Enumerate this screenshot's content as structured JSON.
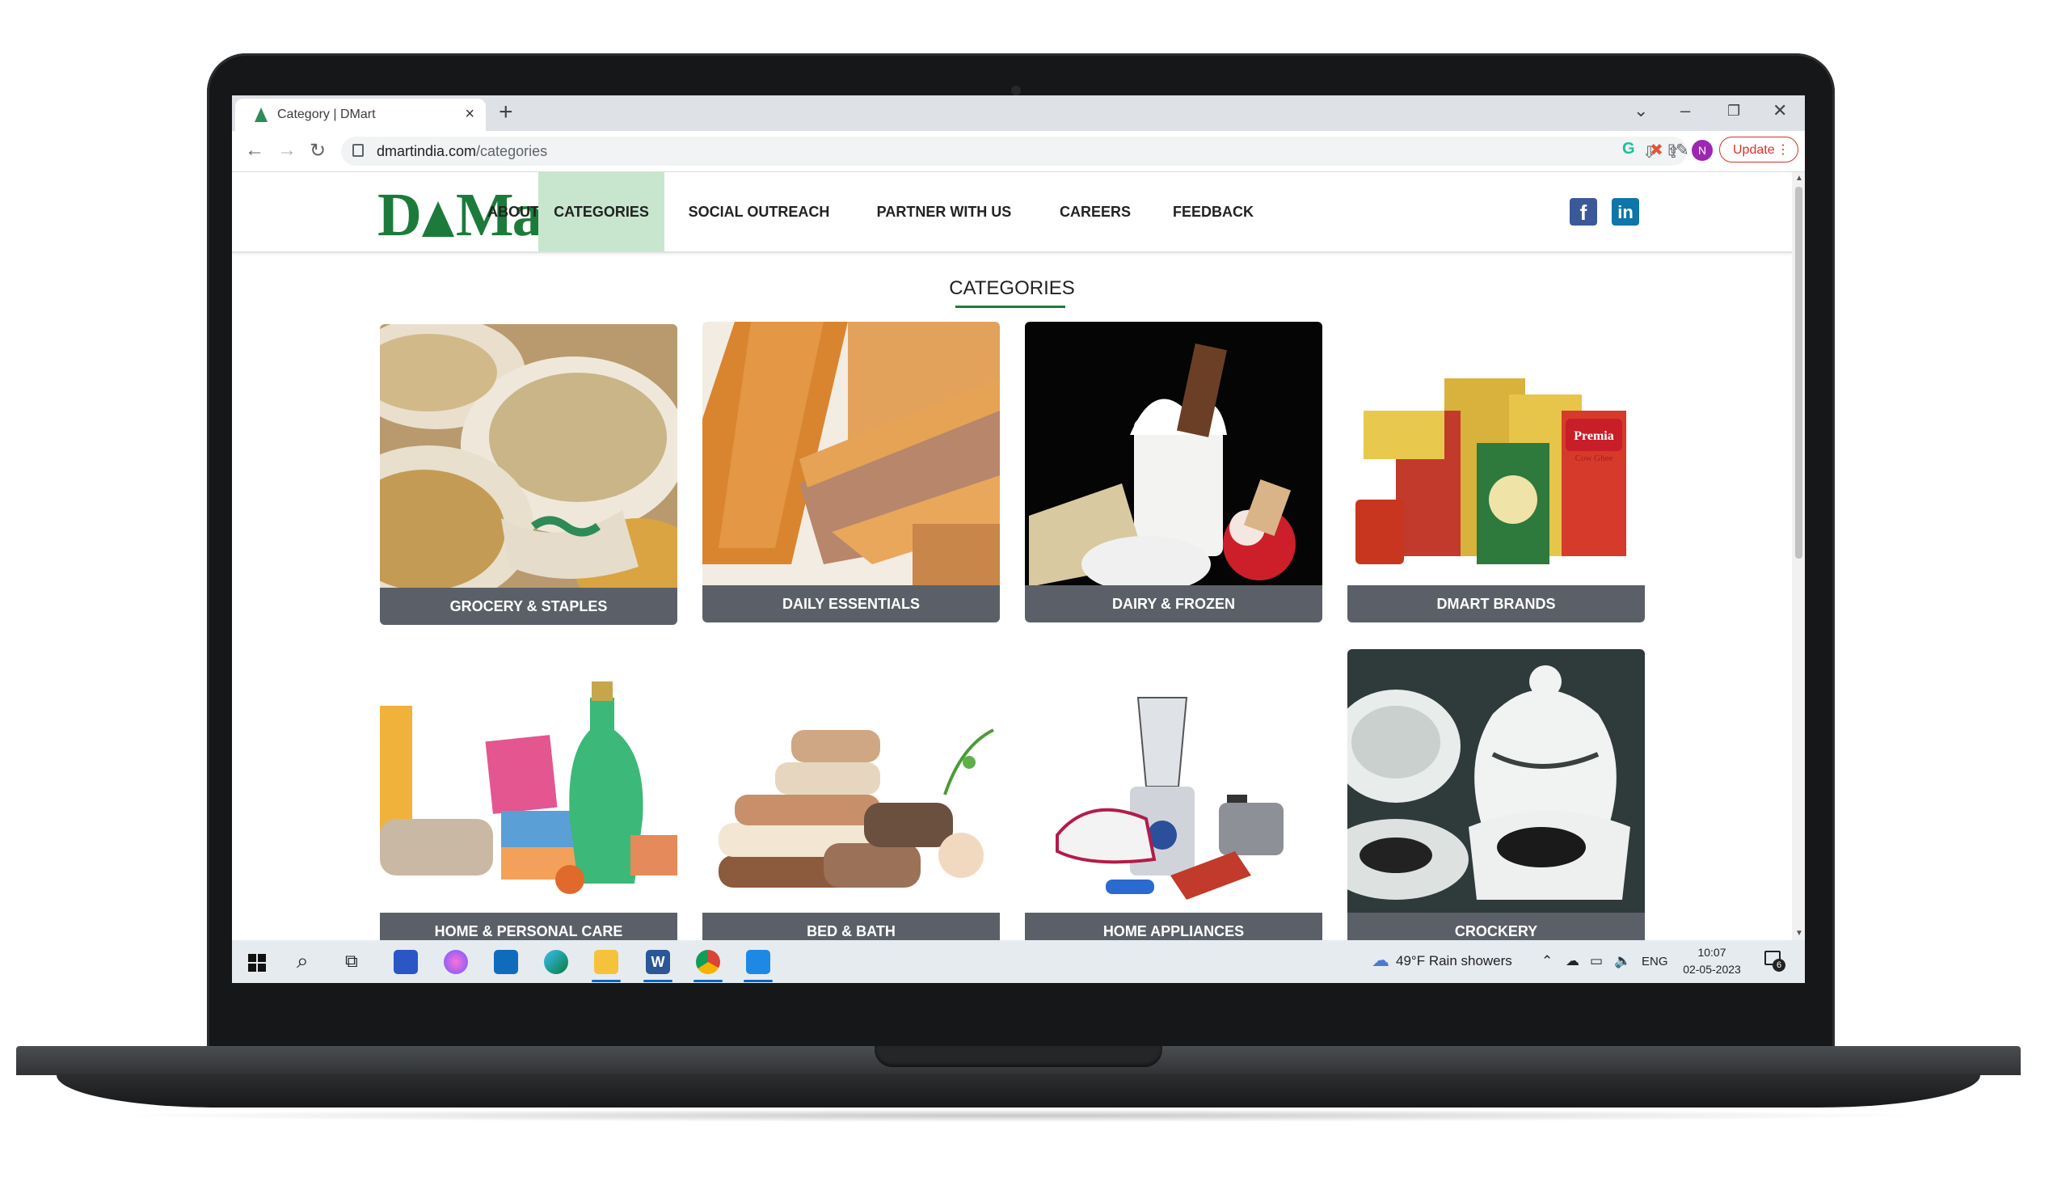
{
  "browser": {
    "tab_title": "Category | DMart",
    "new_tab": "+",
    "close_tab": "×",
    "url_host": "dmartindia.com",
    "url_path": "/categories",
    "update_label": "Update",
    "profile_initial": "N"
  },
  "header": {
    "logo_left": "D",
    "logo_right": "Mart",
    "nav": [
      "ABOUT US",
      "CATEGORIES",
      "SOCIAL OUTREACH",
      "PARTNER WITH US",
      "CAREERS",
      "FEEDBACK"
    ],
    "active_nav": "CATEGORIES",
    "facebook": "f",
    "linkedin": "in"
  },
  "main": {
    "title": "CATEGORIES",
    "categories": [
      {
        "label": "GROCERY & STAPLES"
      },
      {
        "label": "DAILY ESSENTIALS"
      },
      {
        "label": "DAIRY & FROZEN"
      },
      {
        "label": "DMART BRANDS"
      },
      {
        "label": "HOME & PERSONAL CARE"
      },
      {
        "label": "BED & BATH"
      },
      {
        "label": "HOME APPLIANCES"
      },
      {
        "label": "CROCKERY"
      }
    ],
    "brand_pack_text": "Premia",
    "brand_ghee_text": "Cow Ghee"
  },
  "taskbar": {
    "weather": "49°F  Rain showers",
    "language": "ENG",
    "time": "10:07",
    "date": "02-05-2023",
    "notifications": "6"
  },
  "colors": {
    "brand_green": "#1c7b3a",
    "active_nav_bg": "#c8e6cd",
    "label_bg": "#5b6068"
  }
}
